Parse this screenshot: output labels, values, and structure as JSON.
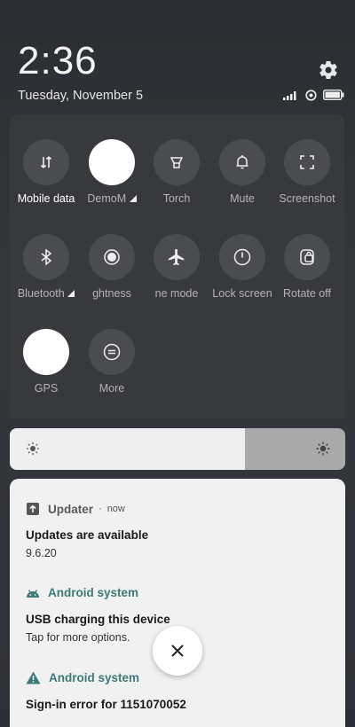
{
  "header": {
    "time": "2:36",
    "date": "Tuesday, November 5"
  },
  "tiles": [
    {
      "label": "Mobile data",
      "icon": "mobile-data-icon",
      "active": true
    },
    {
      "label": "DemoM",
      "icon": "demo-mode-icon",
      "active": false
    },
    {
      "label": "Torch",
      "icon": "torch-icon",
      "active": false
    },
    {
      "label": "Mute",
      "icon": "bell-icon",
      "active": false
    },
    {
      "label": "Screenshot",
      "icon": "screenshot-icon",
      "active": false
    },
    {
      "label": "Bluetooth",
      "icon": "bluetooth-icon",
      "active": false
    },
    {
      "label": "ghtness",
      "icon": "brightness-mode-icon",
      "active": false
    },
    {
      "label": "ne mode",
      "icon": "airplane-icon",
      "active": false
    },
    {
      "label": "Lock screen",
      "icon": "lock-screen-icon",
      "active": false
    },
    {
      "label": "Rotate off",
      "icon": "rotate-lock-icon",
      "active": false
    },
    {
      "label": "GPS",
      "icon": "gps-icon",
      "active": true
    },
    {
      "label": "More",
      "icon": "more-icon",
      "active": false
    }
  ],
  "brightness": {
    "level": 0.7
  },
  "notifications": [
    {
      "app": "Updater",
      "time": "now",
      "title": "Updates are available",
      "body": "9.6.20"
    },
    {
      "app": "Android system",
      "title": "USB charging this device",
      "body": "Tap for more options."
    },
    {
      "app": "Android system",
      "title": "Sign-in error for 1151070052"
    }
  ],
  "colors": {
    "accent_teal": "#3d7a7a"
  }
}
